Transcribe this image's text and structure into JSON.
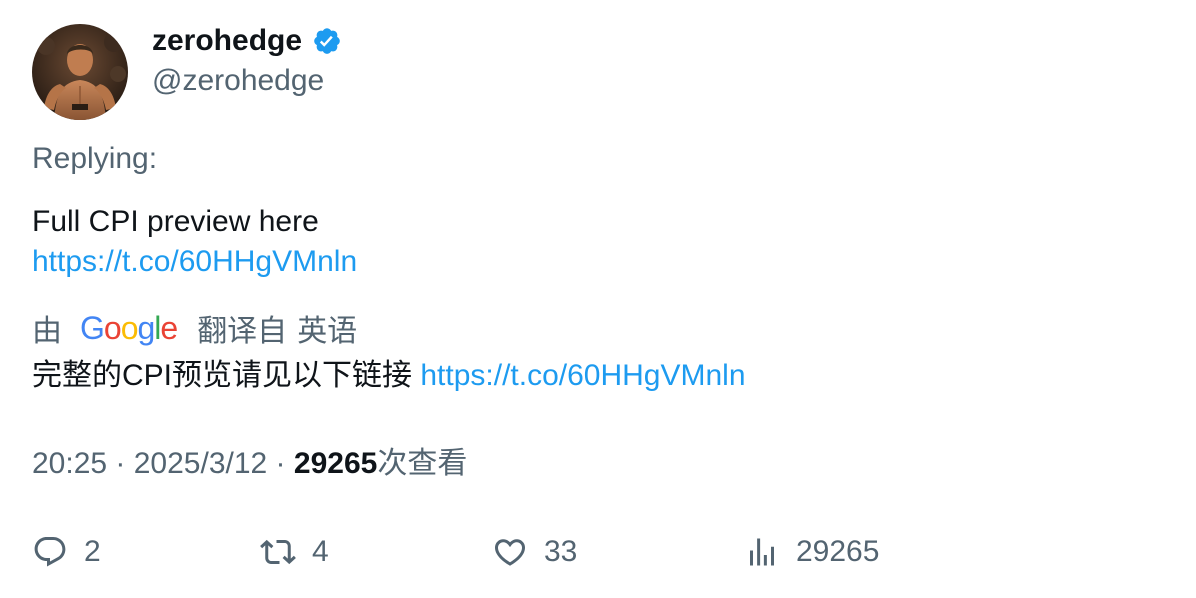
{
  "author": {
    "display_name": "zerohedge",
    "handle": "@zerohedge",
    "verified": true,
    "avatar_icon": "profile-photo"
  },
  "replying": {
    "label": "Replying:"
  },
  "tweet": {
    "text": "Full CPI preview here",
    "link": "https://t.co/60HHgVMnln"
  },
  "translation": {
    "by_label": "由",
    "provider": "Google",
    "from_label": "翻译自",
    "language": "英语",
    "text": "完整的CPI预览请见以下链接",
    "link": "https://t.co/60HHgVMnln"
  },
  "meta": {
    "time": "20:25",
    "separator1": " · ",
    "date": "2025/3/12",
    "separator2": " · ",
    "views": "29265",
    "views_label": "次查看"
  },
  "actions": {
    "reply_count": "2",
    "retweet_count": "4",
    "like_count": "33",
    "views_count": "29265"
  },
  "colors": {
    "link": "#1d9bf0",
    "secondary_text": "#536471",
    "primary_text": "#0f1419",
    "verified_badge": "#1d9bf0"
  }
}
